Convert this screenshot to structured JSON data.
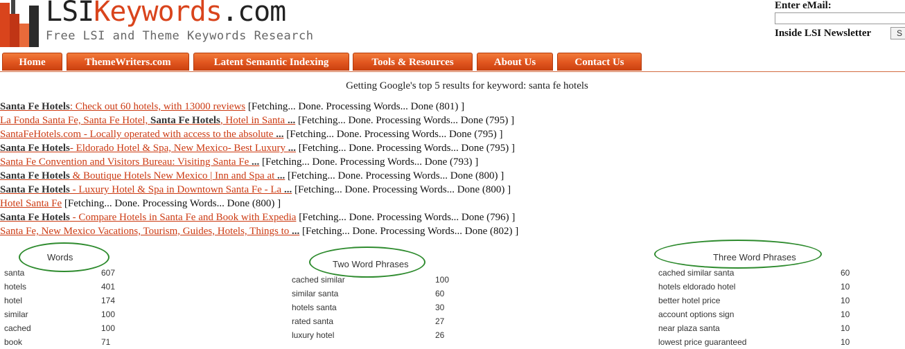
{
  "header": {
    "logo_main": "LSI",
    "logo_accent": "Keywords",
    "logo_tld": ".com",
    "logo_tagline": "Free LSI and Theme Keywords Research"
  },
  "newsletter": {
    "email_label": "Enter eMail:",
    "email_value": "",
    "title": "Inside LSI Newsletter",
    "button_label": "S"
  },
  "nav": [
    "Home",
    "ThemeWriters.com",
    "Latent Semantic Indexing",
    "Tools & Resources",
    "About Us",
    "Contact Us"
  ],
  "status": "Getting Google's top 5 results for keyword: santa fe hotels",
  "results": [
    {
      "parts": [
        {
          "b": "Santa Fe Hotels"
        },
        {
          "t": ": Check out 60 hotels, with 13000 reviews"
        }
      ],
      "status": " [Fetching... Done. Processing Words... Done (801) ]"
    },
    {
      "parts": [
        {
          "t": "La Fonda Santa Fe, Santa Fe Hotel, "
        },
        {
          "b": "Santa Fe Hotels"
        },
        {
          "t": ", Hotel in Santa "
        },
        {
          "b": "..."
        }
      ],
      "status": " [Fetching... Done. Processing Words... Done (795) ]"
    },
    {
      "parts": [
        {
          "t": "SantaFeHotels.com - Locally operated with access to the absolute "
        },
        {
          "b": "..."
        }
      ],
      "status": " [Fetching... Done. Processing Words... Done (795) ]"
    },
    {
      "parts": [
        {
          "b": "Santa Fe Hotels"
        },
        {
          "t": "- Eldorado Hotel & Spa, New Mexico- Best Luxury "
        },
        {
          "b": "..."
        }
      ],
      "status": " [Fetching... Done. Processing Words... Done (795) ]"
    },
    {
      "parts": [
        {
          "t": "Santa Fe Convention and Visitors Bureau: Visiting Santa Fe "
        },
        {
          "b": "..."
        }
      ],
      "status": " [Fetching... Done. Processing Words... Done (793) ]"
    },
    {
      "parts": [
        {
          "b": "Santa Fe Hotels"
        },
        {
          "t": " & Boutique Hotels New Mexico | Inn and Spa at "
        },
        {
          "b": "..."
        }
      ],
      "status": " [Fetching... Done. Processing Words... Done (800) ]"
    },
    {
      "parts": [
        {
          "b": "Santa Fe Hotels"
        },
        {
          "t": " - Luxury Hotel & Spa in Downtown Santa Fe - La "
        },
        {
          "b": "..."
        }
      ],
      "status": " [Fetching... Done. Processing Words... Done (800) ]"
    },
    {
      "parts": [
        {
          "t": "Hotel Santa Fe"
        }
      ],
      "status": " [Fetching... Done. Processing Words... Done (800) ]"
    },
    {
      "parts": [
        {
          "b": "Santa Fe Hotels"
        },
        {
          "t": " - Compare Hotels in Santa Fe and Book with Expedia"
        }
      ],
      "status": " [Fetching... Done. Processing Words... Done (796) ]"
    },
    {
      "parts": [
        {
          "t": "Santa Fe, New Mexico Vacations, Tourism, Guides, Hotels, Things to "
        },
        {
          "b": "..."
        }
      ],
      "status": " [Fetching... Done. Processing Words... Done (802) ]"
    }
  ],
  "tables": {
    "words": {
      "heading": "Words",
      "rows": [
        [
          "santa",
          "607"
        ],
        [
          "hotels",
          "401"
        ],
        [
          "hotel",
          "174"
        ],
        [
          "similar",
          "100"
        ],
        [
          "cached",
          "100"
        ],
        [
          "book",
          "71"
        ]
      ]
    },
    "two_word": {
      "heading": "Two Word Phrases",
      "rows": [
        [
          "cached similar",
          "100"
        ],
        [
          "similar santa",
          "60"
        ],
        [
          "hotels santa",
          "30"
        ],
        [
          "rated santa",
          "27"
        ],
        [
          "luxury hotel",
          "26"
        ]
      ]
    },
    "three_word": {
      "heading": "Three Word Phrases",
      "rows": [
        [
          "cached similar santa",
          "60"
        ],
        [
          "hotels eldorado hotel",
          "10"
        ],
        [
          "better hotel price",
          "10"
        ],
        [
          "account options sign",
          "10"
        ],
        [
          "near plaza santa",
          "10"
        ],
        [
          "lowest price guaranteed",
          "10"
        ]
      ]
    }
  }
}
